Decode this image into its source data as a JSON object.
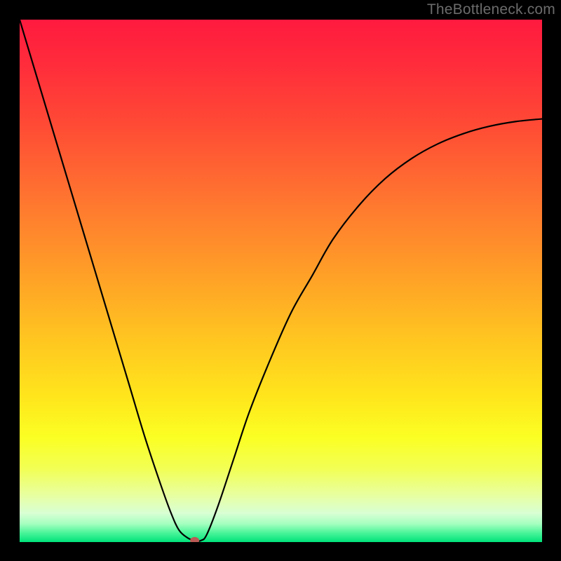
{
  "watermark": "TheBottleneck.com",
  "chart_data": {
    "type": "line",
    "title": "",
    "xlabel": "",
    "ylabel": "",
    "xlim": [
      0,
      100
    ],
    "ylim": [
      0,
      100
    ],
    "grid": false,
    "legend": null,
    "background_gradient": {
      "stops": [
        {
          "offset": 0.0,
          "color": "#ff1a3f"
        },
        {
          "offset": 0.09,
          "color": "#ff2d3b"
        },
        {
          "offset": 0.2,
          "color": "#ff4a35"
        },
        {
          "offset": 0.34,
          "color": "#ff7430"
        },
        {
          "offset": 0.47,
          "color": "#ff9a28"
        },
        {
          "offset": 0.6,
          "color": "#ffc221"
        },
        {
          "offset": 0.72,
          "color": "#ffe51c"
        },
        {
          "offset": 0.8,
          "color": "#fbff23"
        },
        {
          "offset": 0.86,
          "color": "#f2ff55"
        },
        {
          "offset": 0.91,
          "color": "#e8ffa0"
        },
        {
          "offset": 0.945,
          "color": "#d8ffd4"
        },
        {
          "offset": 0.965,
          "color": "#a5ffbf"
        },
        {
          "offset": 0.982,
          "color": "#4cf59a"
        },
        {
          "offset": 1.0,
          "color": "#00e37a"
        }
      ]
    },
    "curve": {
      "x": [
        0,
        3,
        6,
        9,
        12,
        15,
        18,
        21,
        24,
        27,
        29,
        30.5,
        32,
        33,
        33.8,
        34.7,
        35.8,
        38,
        41,
        44,
        48,
        52,
        56,
        60,
        65,
        70,
        75,
        80,
        85,
        90,
        95,
        100
      ],
      "y": [
        100,
        90,
        80,
        70,
        60,
        50,
        40,
        30,
        20,
        11,
        5.5,
        2.3,
        0.9,
        0.4,
        0.2,
        0.3,
        1.4,
        7,
        16,
        25,
        35,
        44,
        51,
        58,
        64.5,
        69.6,
        73.4,
        76.2,
        78.2,
        79.6,
        80.5,
        81.0
      ]
    },
    "marker": {
      "x": 33.5,
      "y": 0.3
    }
  }
}
